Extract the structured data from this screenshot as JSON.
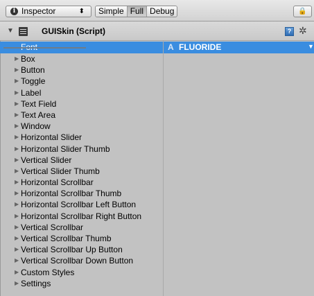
{
  "toolbar": {
    "inspector_label": "Inspector",
    "inspector_arrows": "⬍",
    "modes": [
      "Simple",
      "Full",
      "Debug"
    ],
    "active_mode": "Full"
  },
  "component": {
    "title": "GUISkin (Script)",
    "help_glyph": "?",
    "gear_glyph": "✲"
  },
  "font_property": {
    "label": "Font",
    "value": "FLUORIDE",
    "value_icon": "font-asset-icon",
    "dropdown_glyph": "▼"
  },
  "properties": [
    "Box",
    "Button",
    "Toggle",
    "Label",
    "Text Field",
    "Text Area",
    "Window",
    "Horizontal Slider",
    "Horizontal Slider Thumb",
    "Vertical Slider",
    "Vertical Slider Thumb",
    "Horizontal Scrollbar",
    "Horizontal Scrollbar Thumb",
    "Horizontal Scrollbar Left Button",
    "Horizontal Scrollbar Right Button",
    "Vertical Scrollbar",
    "Vertical Scrollbar Thumb",
    "Vertical Scrollbar Up Button",
    "Vertical Scrollbar Down Button",
    "Custom Styles",
    "Settings"
  ],
  "colors": {
    "selection": "#3a8de0",
    "panel": "#c2c2c2"
  }
}
